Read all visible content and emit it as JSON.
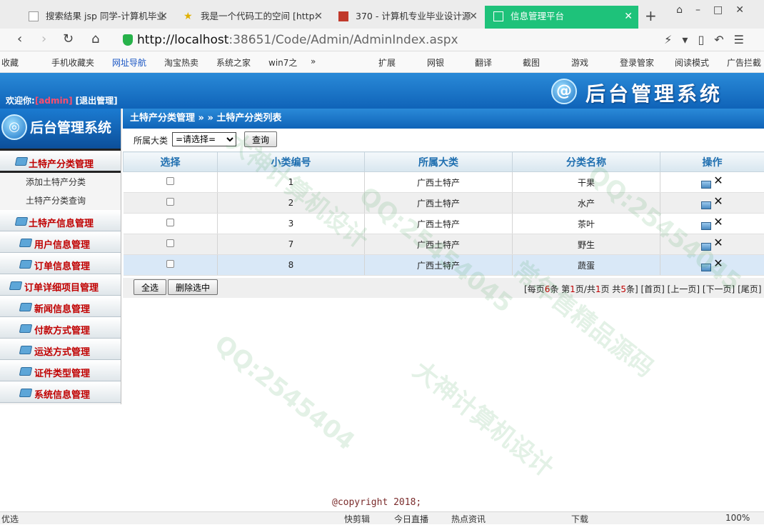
{
  "browser": {
    "tabs": [
      {
        "title": "搜索结果 jsp 同学-计算机毕业",
        "active": false
      },
      {
        "title": "我是一个代码工的空间 [http:",
        "active": false
      },
      {
        "title": "370 - 计算机专业毕业设计源",
        "active": false
      },
      {
        "title": "信息管理平台",
        "active": true
      }
    ],
    "url_host": "http://localhost",
    "url_path": ":38651/Code/Admin/AdminIndex.aspx",
    "bookmarks": [
      "收藏",
      "手机收藏夹",
      "网址导航",
      "淘宝热卖",
      "系统之家",
      "win7之",
      "扩展",
      "网银",
      "翻译",
      "截图",
      "游戏",
      "登录管家",
      "阅读模式",
      "广告拦截"
    ],
    "accent": "#1ec27a"
  },
  "header": {
    "welcome_label": "欢迎你:",
    "username": "[admin]",
    "logout_label": "[退出管理]",
    "brand_title": "后台管理系统",
    "brand_symbol": "@"
  },
  "sidebar": {
    "brand_title": "后台管理系统",
    "menus": [
      {
        "label": "土特产分类管理",
        "open": true,
        "items": [
          "添加土特产分类",
          "土特产分类查询"
        ]
      },
      {
        "label": "土特产信息管理"
      },
      {
        "label": "用户信息管理"
      },
      {
        "label": "订单信息管理"
      },
      {
        "label": "订单详细项目管理"
      },
      {
        "label": "新闻信息管理"
      },
      {
        "label": "付款方式管理"
      },
      {
        "label": "运送方式管理"
      },
      {
        "label": "证件类型管理"
      },
      {
        "label": "系统信息管理"
      }
    ]
  },
  "main": {
    "breadcrumb": "土特产分类管理 » » 土特产分类列表",
    "filter": {
      "label": "所属大类",
      "selected": "=请选择=",
      "query_button": "查询"
    },
    "table": {
      "headers": [
        "选择",
        "小类编号",
        "所属大类",
        "分类名称",
        "操作"
      ],
      "rows": [
        {
          "id": "1",
          "category": "广西土特产",
          "name": "干果"
        },
        {
          "id": "2",
          "category": "广西土特产",
          "name": "水产"
        },
        {
          "id": "3",
          "category": "广西土特产",
          "name": "茶叶"
        },
        {
          "id": "7",
          "category": "广西土特产",
          "name": "野生"
        },
        {
          "id": "8",
          "category": "广西土特产",
          "name": "蔬蛋"
        }
      ]
    },
    "select_all_button": "全选",
    "delete_selected_button": "删除选中",
    "pager": {
      "prefix": "[每页",
      "per_page": "6",
      "mid1": "条 第",
      "current": "1",
      "mid2": "页/共",
      "total_pages": "1",
      "mid3": "页 共",
      "total": "5",
      "suffix": "条]",
      "first": "[首页]",
      "prev": "[上一页]",
      "next": "[下一页]",
      "last": "[尾页]"
    },
    "copyright": "@copyright 2018;"
  },
  "statusbar": {
    "left": "优选",
    "items": [
      "快剪辑",
      "今日直播",
      "热点资讯",
      "下载",
      "100%"
    ]
  },
  "watermarks": [
    "大神计算机设计",
    "QQ:25454045",
    "常年售精品源码",
    "QQ:2545404",
    "大神计算机设计",
    "QQ:25454045"
  ]
}
